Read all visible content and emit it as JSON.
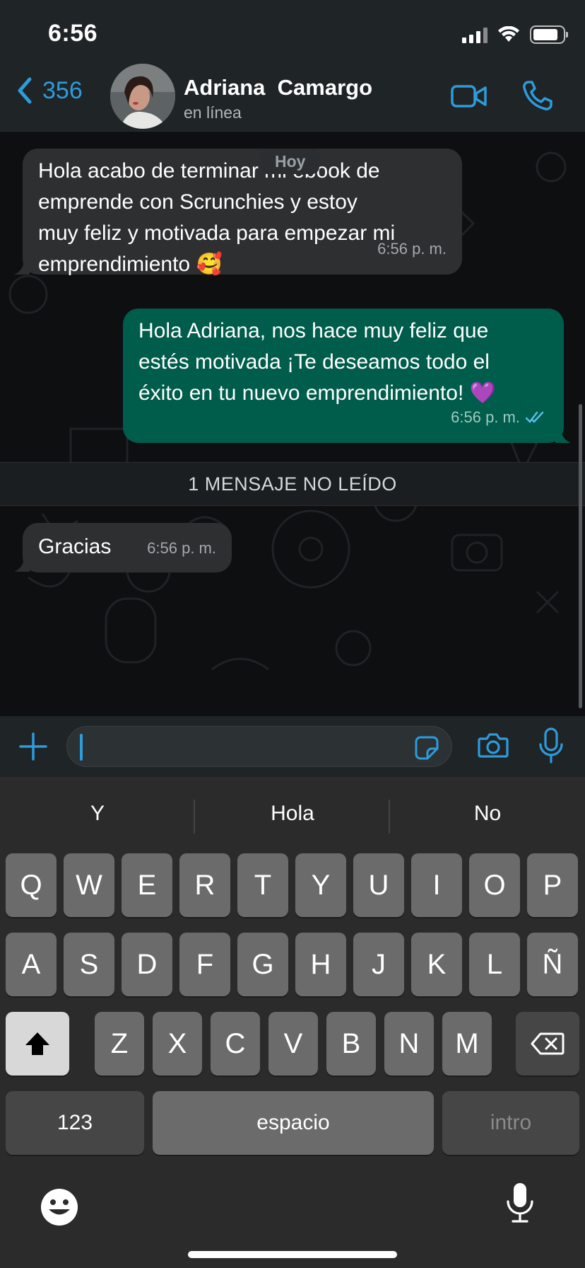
{
  "status": {
    "time": "6:56",
    "battery_level": 0.85
  },
  "header": {
    "back_count": "356",
    "contact_name": "Adriana  Camargo",
    "contact_status": "en línea",
    "icons": [
      "chevron-left-icon",
      "video-camera-icon",
      "phone-icon"
    ]
  },
  "chat": {
    "date_label": "Hoy",
    "messages": [
      {
        "direction": "in",
        "lines": [
          "Hola acabo de terminar mi ebook de",
          "emprende con Scrunchies y estoy",
          "muy feliz y motivada para empezar mi",
          "emprendimiento 🥰"
        ],
        "time": "6:56 p. m."
      },
      {
        "direction": "out",
        "lines": [
          "Hola Adriana, nos hace muy feliz que",
          "estés motivada ¡Te deseamos todo el",
          "éxito en tu nuevo emprendimiento! 💜"
        ],
        "time": "6:56 p. m.",
        "read": true
      },
      {
        "direction": "in",
        "lines": [
          "Gracias"
        ],
        "time": "6:56 p. m."
      }
    ],
    "unread_label": "1 MENSAJE NO LEÍDO"
  },
  "input": {
    "placeholder": ""
  },
  "keyboard": {
    "suggestions": [
      "Y",
      "Hola",
      "No"
    ],
    "row1": [
      "Q",
      "W",
      "E",
      "R",
      "T",
      "Y",
      "U",
      "I",
      "O",
      "P"
    ],
    "row2": [
      "A",
      "S",
      "D",
      "F",
      "G",
      "H",
      "J",
      "K",
      "L",
      "Ñ"
    ],
    "row3": [
      "Z",
      "X",
      "C",
      "V",
      "B",
      "N",
      "M"
    ],
    "numbers_label": "123",
    "space_label": "espacio",
    "return_label": "intro"
  },
  "colors": {
    "accent": "#2d9cdb",
    "outgoing_bubble": "#005c4b",
    "incoming_bubble": "#2d2f31",
    "header": "#1f2427"
  }
}
